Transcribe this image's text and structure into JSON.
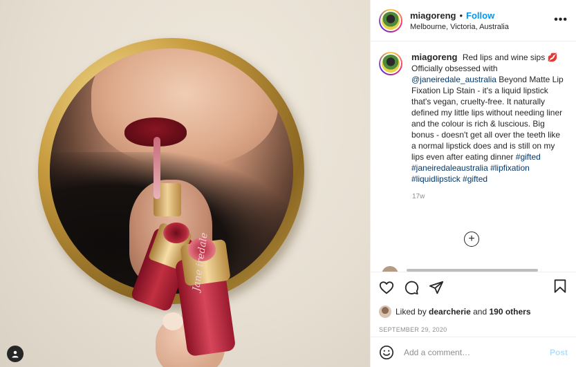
{
  "photo": {
    "alt": "",
    "tube_brand_text": "Jane iredale",
    "user_tag_icon": "person-icon"
  },
  "header": {
    "username": "miagoreng",
    "separator": "•",
    "follow_label": "Follow",
    "location": "Melbourne, Victoria, Australia",
    "more_label": "•••"
  },
  "caption": {
    "username": "miagoreng",
    "text_1": "Red lips and wine sips",
    "emoji": "💋",
    "text_2": "Officially obsessed with",
    "mention": "@janeiredale_australia",
    "text_3": "Beyond Matte Lip Fixation Lip Stain - it's a liquid lipstick that's vegan, cruelty-free. It naturally defined my little lips without needing liner and the colour is rich & luscious. Big bonus - doesn't get all over the teeth like a normal lipstick does and is still on my lips even after eating dinner",
    "hashtags": [
      "#gifted",
      "#janeiredaleaustralia",
      "#lipfixation",
      "#liquidlipstick",
      "#gifted"
    ],
    "time_ago": "17w"
  },
  "load_more_label": "+",
  "actions": {
    "icons": [
      "heart-icon",
      "comment-icon",
      "share-icon",
      "bookmark-icon"
    ],
    "liked_by_prefix": "Liked by",
    "liked_by_user": "dearcherie",
    "liked_by_and": "and",
    "liked_by_others": "190 others",
    "date": "SEPTEMBER 29, 2020"
  },
  "add_comment": {
    "placeholder": "Add a comment…",
    "post_label": "Post",
    "emoji_icon": "smiley-icon"
  },
  "colors": {
    "accent": "#0095f6",
    "link": "#00376b",
    "muted": "#8e8e8e",
    "post_disabled": "#b2dffc"
  }
}
